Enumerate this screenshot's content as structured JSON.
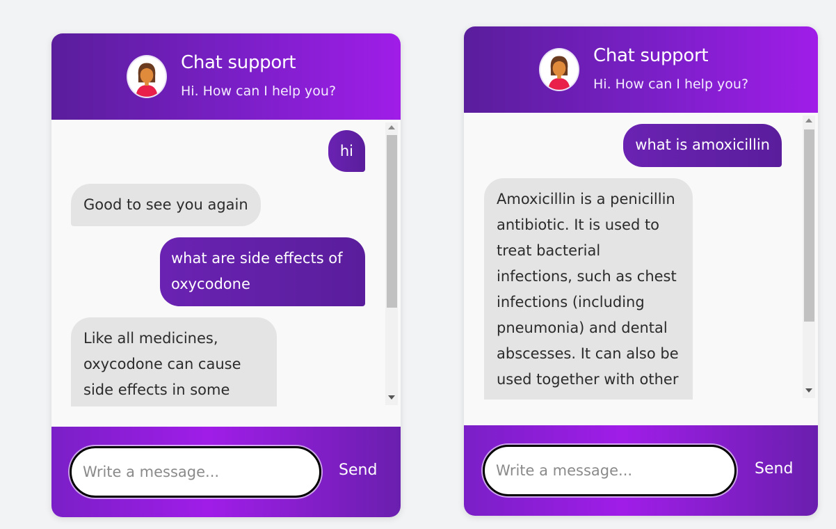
{
  "widgets": [
    {
      "header": {
        "title": "Chat support",
        "subtitle": "Hi. How can I help you?"
      },
      "messages": [
        {
          "sender": "user",
          "text": "hi"
        },
        {
          "sender": "bot",
          "text": "Good to see you again"
        },
        {
          "sender": "user",
          "text": "what are side effects of oxycodone"
        },
        {
          "sender": "bot",
          "text": "Like all medicines, oxycodone can cause side effects in some"
        }
      ],
      "input": {
        "placeholder": "Write a message...",
        "value": ""
      },
      "send_label": "Send"
    },
    {
      "header": {
        "title": "Chat support",
        "subtitle": "Hi. How can I help you?"
      },
      "messages": [
        {
          "sender": "user",
          "text": "what is amoxicillin"
        },
        {
          "sender": "bot",
          "text": "Amoxicillin is a penicillin antibiotic. It is used to treat bacterial infections, such as chest infections (including pneumonia) and dental abscesses. It can also be used together with other"
        }
      ],
      "input": {
        "placeholder": "Write a message...",
        "value": ""
      },
      "send_label": "Send"
    }
  ],
  "colors": {
    "header_start": "#5a1e9c",
    "header_end": "#a01de8",
    "user_bubble": "#5a1e9c",
    "bot_bubble": "#e4e4e4"
  }
}
